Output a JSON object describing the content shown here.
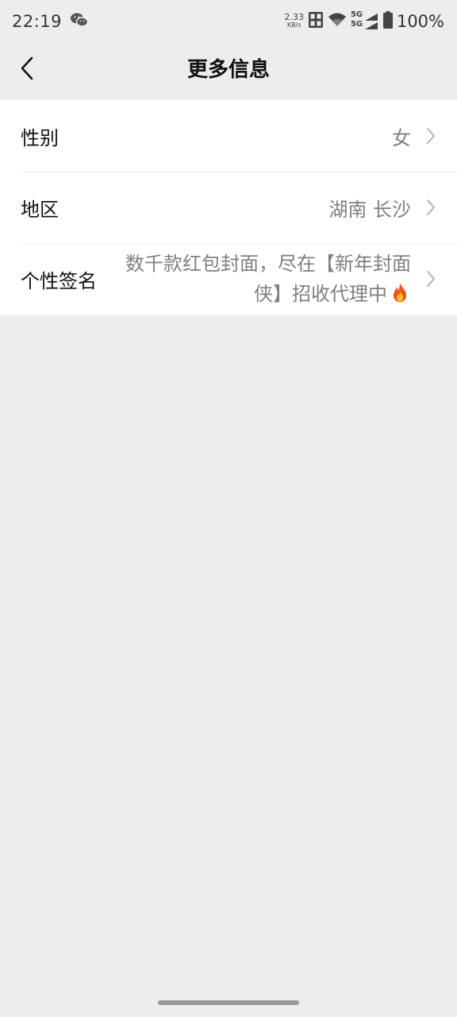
{
  "status_bar": {
    "time": "22:19",
    "net_speed_value": "2.33",
    "net_speed_unit": "KB/s",
    "signal_label_1": "5G",
    "signal_label_2": "5G",
    "battery": "100%",
    "icons": [
      "wechat-icon",
      "hd-icon",
      "wifi-icon",
      "signal-icon",
      "battery-icon"
    ]
  },
  "nav": {
    "title": "更多信息",
    "back_icon": "chevron-left-icon"
  },
  "items": [
    {
      "label": "性别",
      "value": "女"
    },
    {
      "label": "地区",
      "value": "湖南 长沙"
    },
    {
      "label": "个性签名",
      "value": "数千款红包封面，尽在【新年封面侠】招收代理中",
      "trailing_icon": "fire-icon"
    }
  ],
  "colors": {
    "background": "#ededed",
    "list_bg": "#ffffff",
    "label": "#111111",
    "value": "#7f7f7f"
  }
}
